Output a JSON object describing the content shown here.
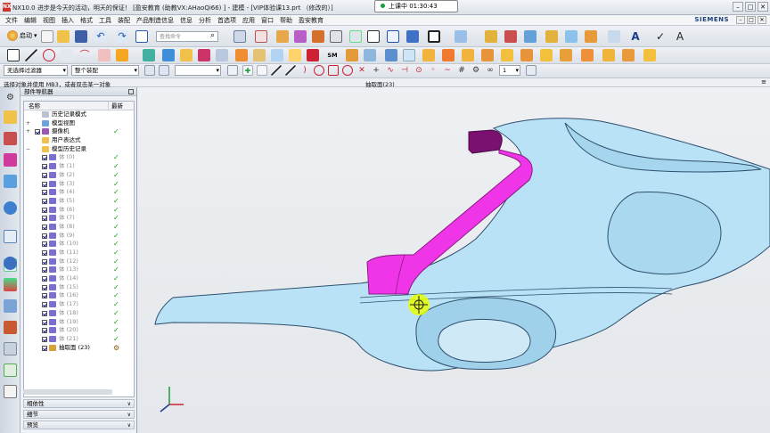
{
  "window": {
    "title": "NX10.0 进步是今天的活动，明天的保证！ [盈安教育 (助教VX:AHaoQi66) ] - 建模 - [VIP体验课13.prt （修改的）]",
    "logo_text": "NX",
    "recording": "上课中 01:30:43",
    "controls": [
      "–",
      "□",
      "✕"
    ]
  },
  "menubar": {
    "items": [
      "文件",
      "编辑",
      "视图",
      "插入",
      "格式",
      "工具",
      "装配",
      "产品制造信息",
      "信息",
      "分析",
      "首选项",
      "应用",
      "窗口",
      "帮助",
      "盈安教育"
    ],
    "brand": "SIEMENS",
    "mini_controls": [
      "–",
      "□",
      "✕"
    ]
  },
  "toolbar1": {
    "start_label": "启动",
    "search_placeholder": "查找命令",
    "search_icon": "search-icon"
  },
  "toolbar3": {
    "filter_select": "无选择过滤器",
    "scope_select": "整个装配",
    "snap_select": "",
    "count_select": "1"
  },
  "status": {
    "prompt": "选择对象并使用 MB3，或者双击某一对象",
    "view_label": "抽取面(23)",
    "menu_glyph": "≡"
  },
  "navigator": {
    "title": "部件导航器",
    "col_name": "名称",
    "col_latest": "最新",
    "rows": [
      {
        "exp": "",
        "label": "历史记录模式",
        "icon": "history-icon",
        "check": "",
        "muted": false
      },
      {
        "exp": "+",
        "label": "模型视图",
        "icon": "views-icon",
        "check": "",
        "muted": false
      },
      {
        "exp": "+",
        "label": "摄像机",
        "icon": "camera-icon",
        "check": "✓",
        "muted": false
      },
      {
        "exp": "",
        "label": "用户表达式",
        "icon": "folder-icon",
        "check": "",
        "muted": false
      },
      {
        "exp": "−",
        "label": "模型历史记录",
        "icon": "folder-icon",
        "check": "",
        "muted": false
      },
      {
        "exp": "",
        "label": "体 (0)",
        "icon": "body-icon",
        "check": "✓",
        "muted": true
      },
      {
        "exp": "",
        "label": "体 (1)",
        "icon": "body-icon",
        "check": "✓",
        "muted": true
      },
      {
        "exp": "",
        "label": "体 (2)",
        "icon": "body-icon",
        "check": "✓",
        "muted": true
      },
      {
        "exp": "",
        "label": "体 (3)",
        "icon": "body-icon",
        "check": "✓",
        "muted": true
      },
      {
        "exp": "",
        "label": "体 (4)",
        "icon": "body-icon",
        "check": "✓",
        "muted": true
      },
      {
        "exp": "",
        "label": "体 (5)",
        "icon": "body-icon",
        "check": "✓",
        "muted": true
      },
      {
        "exp": "",
        "label": "体 (6)",
        "icon": "body-icon",
        "check": "✓",
        "muted": true
      },
      {
        "exp": "",
        "label": "体 (7)",
        "icon": "body-icon",
        "check": "✓",
        "muted": true
      },
      {
        "exp": "",
        "label": "体 (8)",
        "icon": "body-icon",
        "check": "✓",
        "muted": true
      },
      {
        "exp": "",
        "label": "体 (9)",
        "icon": "body-icon",
        "check": "✓",
        "muted": true
      },
      {
        "exp": "",
        "label": "体 (10)",
        "icon": "body-icon",
        "check": "✓",
        "muted": true
      },
      {
        "exp": "",
        "label": "体 (11)",
        "icon": "body-icon",
        "check": "✓",
        "muted": true
      },
      {
        "exp": "",
        "label": "体 (12)",
        "icon": "body-icon",
        "check": "✓",
        "muted": true
      },
      {
        "exp": "",
        "label": "体 (13)",
        "icon": "body-icon",
        "check": "✓",
        "muted": true
      },
      {
        "exp": "",
        "label": "体 (14)",
        "icon": "body-icon",
        "check": "✓",
        "muted": true
      },
      {
        "exp": "",
        "label": "体 (15)",
        "icon": "body-icon",
        "check": "✓",
        "muted": true
      },
      {
        "exp": "",
        "label": "体 (16)",
        "icon": "body-icon",
        "check": "✓",
        "muted": true
      },
      {
        "exp": "",
        "label": "体 (17)",
        "icon": "body-icon",
        "check": "✓",
        "muted": true
      },
      {
        "exp": "",
        "label": "体 (18)",
        "icon": "body-icon",
        "check": "✓",
        "muted": true
      },
      {
        "exp": "",
        "label": "体 (19)",
        "icon": "body-icon",
        "check": "✓",
        "muted": true
      },
      {
        "exp": "",
        "label": "体 (20)",
        "icon": "body-icon",
        "check": "✓",
        "muted": true
      },
      {
        "exp": "",
        "label": "体 (21)",
        "icon": "body-icon",
        "check": "✓",
        "muted": true
      },
      {
        "exp": "",
        "label": "抽取面 (23)",
        "icon": "extract-face-icon",
        "check": "⚙",
        "muted": false
      }
    ],
    "subpanels": [
      {
        "label": "相依性",
        "arrow": "∨"
      },
      {
        "label": "细节",
        "arrow": "∨"
      },
      {
        "label": "预览",
        "arrow": "∨"
      }
    ]
  },
  "colors": {
    "model_fill": "#b9e2f6",
    "model_edge": "#2f4f6e",
    "selected_face": "#f035e8",
    "selected_face_dark": "#7a1070",
    "cursor_halo": "#e6ff00"
  }
}
